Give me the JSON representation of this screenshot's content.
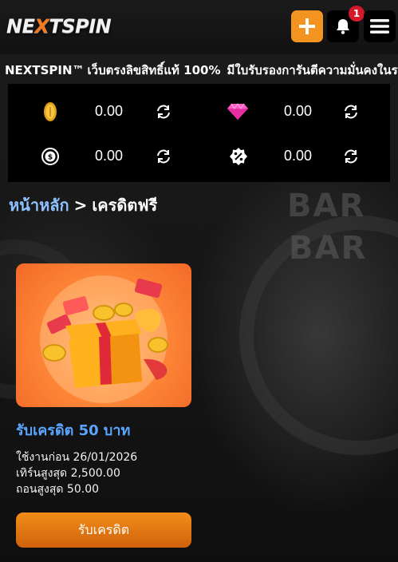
{
  "header": {
    "logo_prefix": "NE",
    "logo_x": "X",
    "logo_suffix": "TSPIN",
    "add_icon": "plus-icon",
    "bell_icon": "bell-icon",
    "notification_count": "1",
    "menu_icon": "hamburger-menu-icon",
    "accent_color": "#f49420"
  },
  "marquee": {
    "icon_start": "mascot-icon",
    "brand": "NEXTSPIN™",
    "text_1": "เว็บตรงลิขสิทธิ์แท้ 100%",
    "badge_icon": "shield-badge-icon",
    "text_2": "มีใบรับรองการันตีความมั่นคงในระบบ"
  },
  "wallet": {
    "coin_balance": "0.00",
    "gem_balance": "0.00",
    "cashback_balance": "0.00",
    "discount_balance": "0.00"
  },
  "breadcrumb": {
    "home": "หน้าหลัก",
    "separator": ">",
    "current": "เครดิตฟรี"
  },
  "promo": {
    "image_icon": "gift-box-image",
    "title": "รับเครดิต 50 บาท",
    "expire": "ใช้งานก่อน 26/01/2026",
    "deposit_max": "เทิร์นสูงสุด 2,500.00",
    "withdraw_max": "ถอนสูงสุด 50.00",
    "button_label": "รับเครดิต"
  }
}
